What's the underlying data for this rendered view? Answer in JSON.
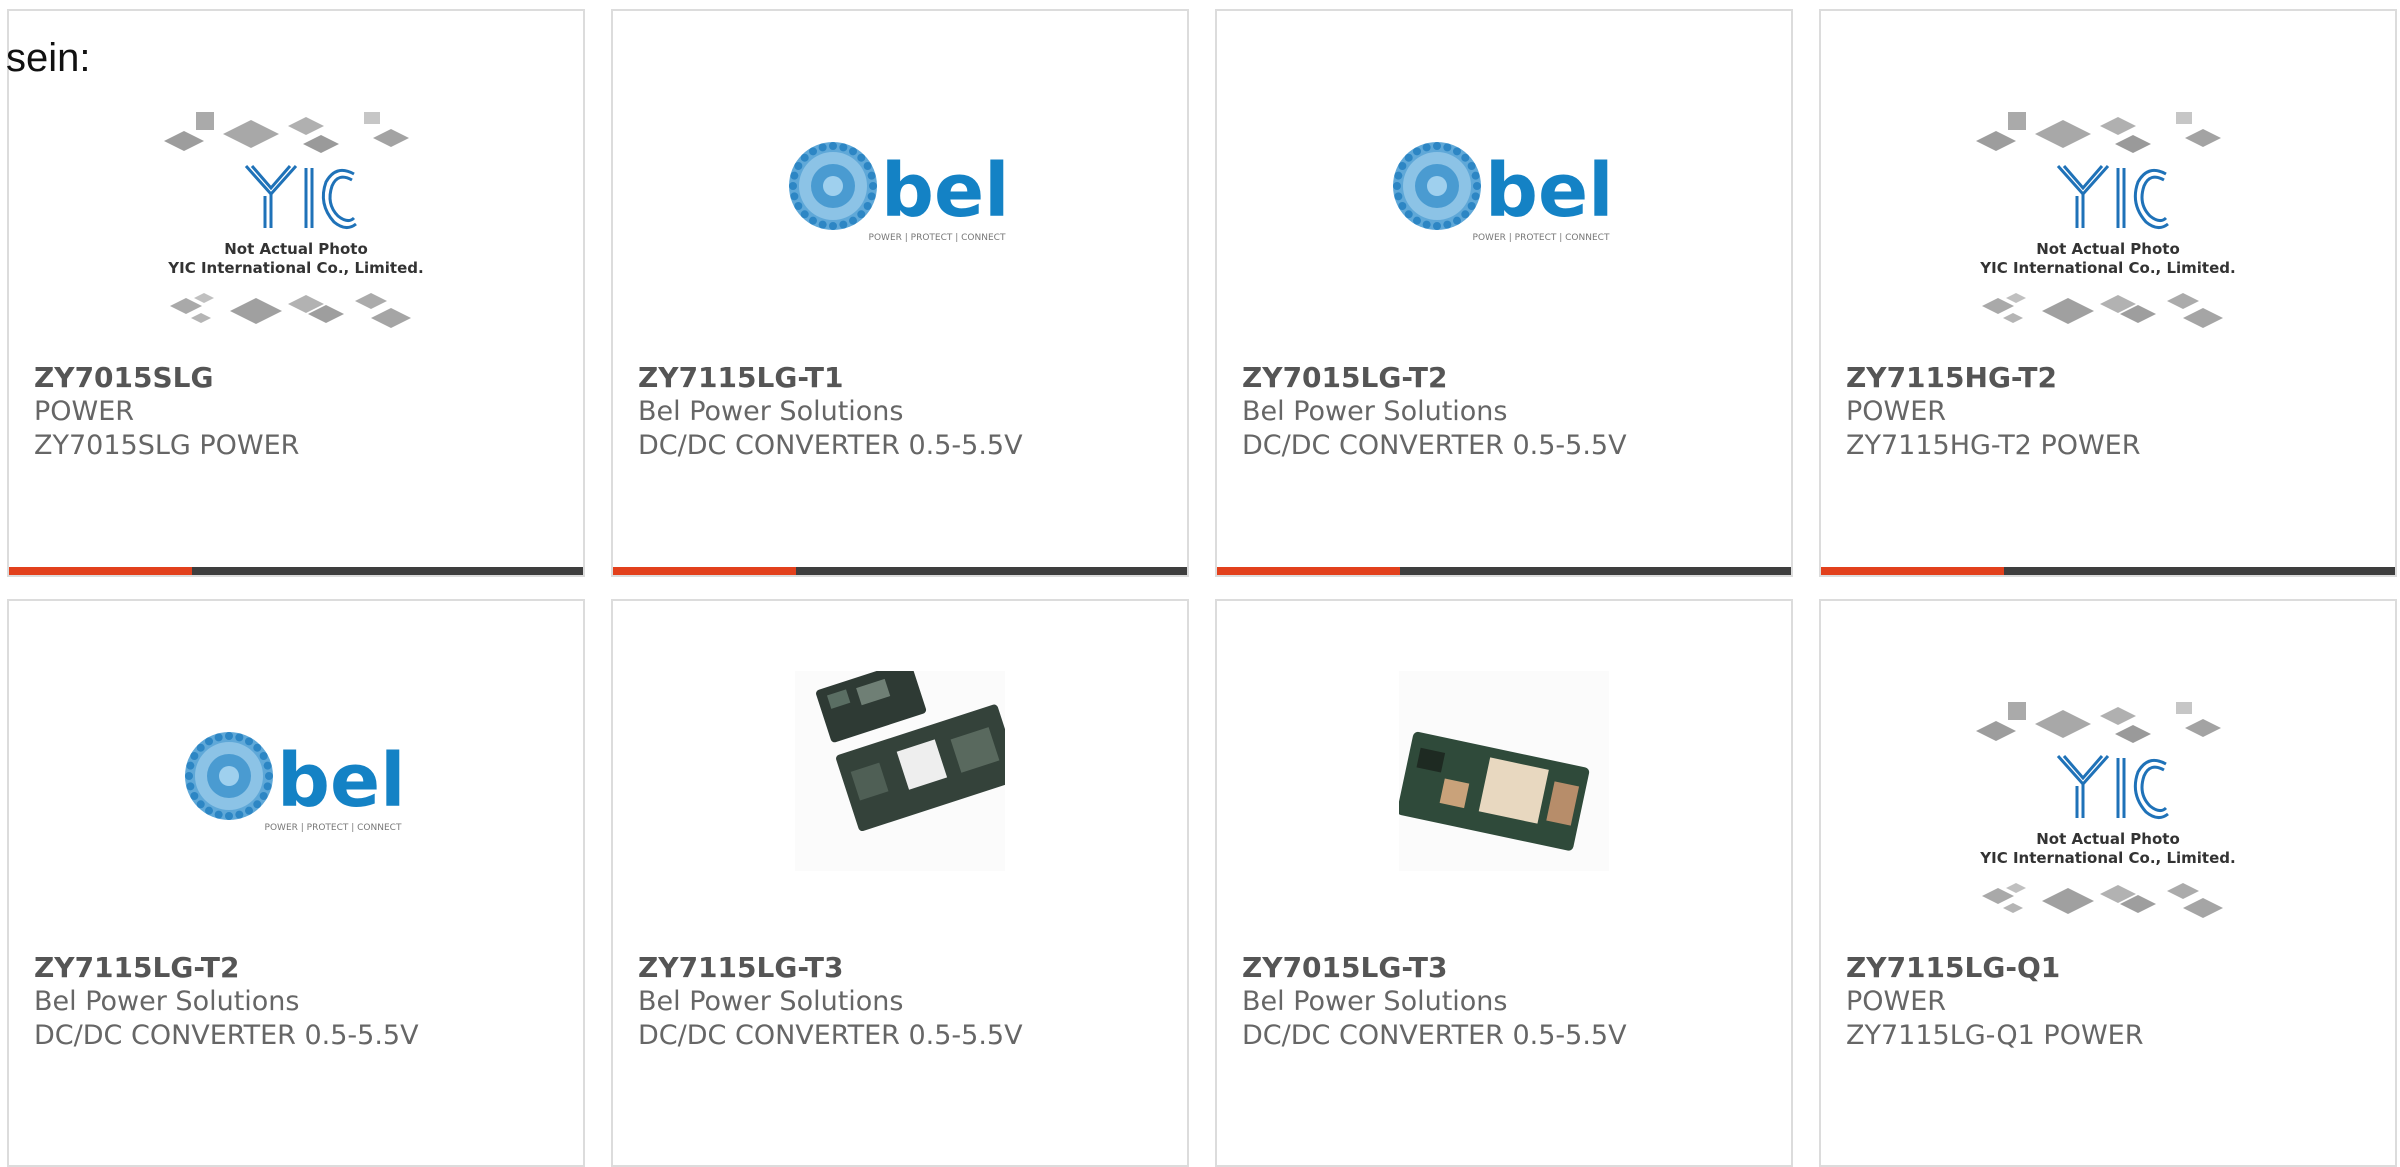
{
  "intro_text": "sein:",
  "colors": {
    "accent": "#e2401c",
    "bar_dark": "#3e3e3e",
    "bel_blue": "#1482c5",
    "yic_blue": "#1f72b8"
  },
  "placeholder_caption": {
    "line1": "Not Actual Photo",
    "line2": "YIC International Co., Limited."
  },
  "bel_logo": {
    "wordmark": "bel",
    "tagline": "POWER | PROTECT | CONNECT"
  },
  "products": [
    {
      "part": "ZY7015SLG",
      "manufacturer": "POWER",
      "description": "ZY7015SLG POWER",
      "image": "yic-placeholder"
    },
    {
      "part": "ZY7115LG-T1",
      "manufacturer": "Bel Power Solutions",
      "description": "DC/DC CONVERTER 0.5-5.5V",
      "image": "bel-logo"
    },
    {
      "part": "ZY7015LG-T2",
      "manufacturer": "Bel Power Solutions",
      "description": "DC/DC CONVERTER 0.5-5.5V",
      "image": "bel-logo"
    },
    {
      "part": "ZY7115HG-T2",
      "manufacturer": "POWER",
      "description": "ZY7115HG-T2 POWER",
      "image": "yic-placeholder"
    },
    {
      "part": "ZY7115LG-T2",
      "manufacturer": "Bel Power Solutions",
      "description": "DC/DC CONVERTER 0.5-5.5V",
      "image": "bel-logo"
    },
    {
      "part": "ZY7115LG-T3",
      "manufacturer": "Bel Power Solutions",
      "description": "DC/DC CONVERTER 0.5-5.5V",
      "image": "module-photo"
    },
    {
      "part": "ZY7015LG-T3",
      "manufacturer": "Bel Power Solutions",
      "description": "DC/DC CONVERTER 0.5-5.5V",
      "image": "module-photo-single"
    },
    {
      "part": "ZY7115LG-Q1",
      "manufacturer": "POWER",
      "description": "ZY7115LG-Q1 POWER",
      "image": "yic-placeholder"
    }
  ]
}
